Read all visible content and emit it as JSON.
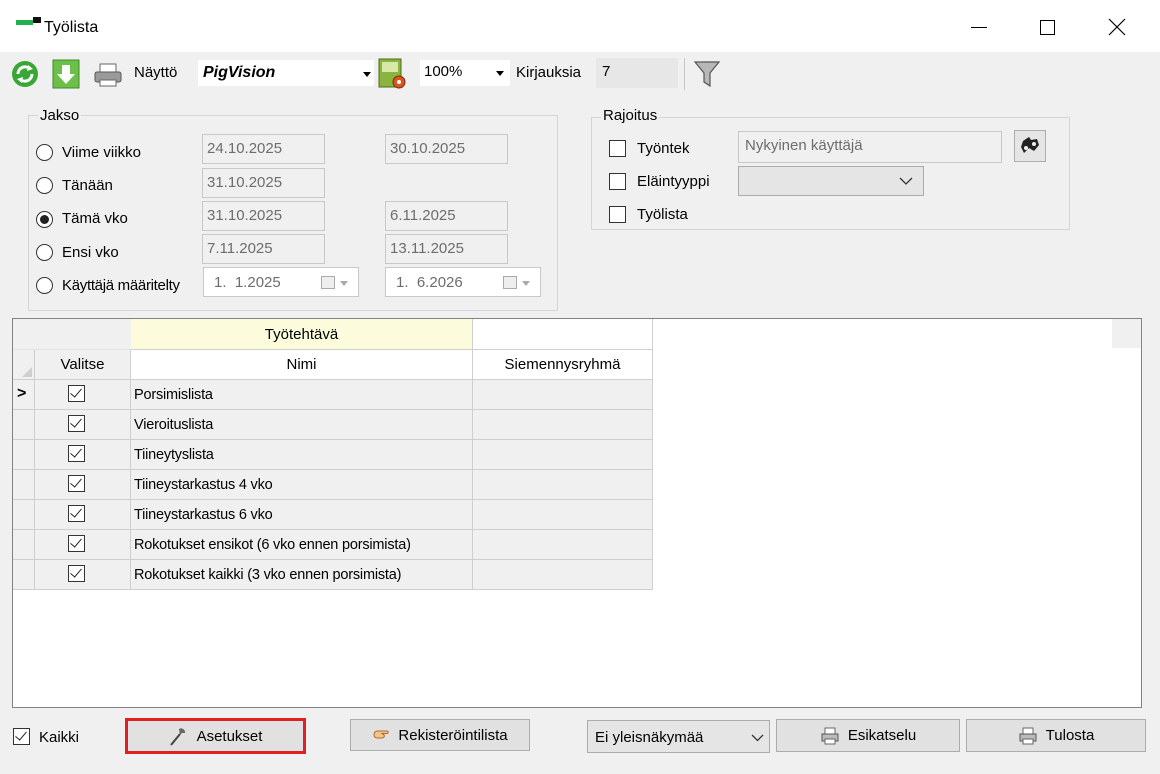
{
  "window": {
    "title": "Työlista",
    "minimize_icon": "minimize-icon",
    "maximize_icon": "maximize-icon",
    "close_icon": "close-icon"
  },
  "toolbar": {
    "refresh_icon": "refresh-icon",
    "export_icon": "download-arrow-icon",
    "print_icon": "printer-icon",
    "naytto_label": "Näyttö",
    "naytto_value": "PigVision",
    "settings_icon": "document-gear-icon",
    "zoom_value": "100%",
    "kirjauksia_label": "Kirjauksia",
    "kirjauksia_value": "7",
    "filter_icon": "funnel-icon"
  },
  "jakso": {
    "title": "Jakso",
    "options": [
      {
        "label": "Viime viikko",
        "from": "24.10.2025",
        "to": "30.10.2025",
        "selected": false
      },
      {
        "label": "Tänään",
        "from": "31.10.2025",
        "to": "",
        "selected": false
      },
      {
        "label": "Tämä vko",
        "from": "31.10.2025",
        "to": "6.11.2025",
        "selected": true
      },
      {
        "label": "Ensi vko",
        "from": "7.11.2025",
        "to": "13.11.2025",
        "selected": false
      },
      {
        "label": "Käyttäjä määritelty",
        "from": "1.  1.2025",
        "to": "1.  6.2026",
        "selected": false
      }
    ]
  },
  "rajoitus": {
    "title": "Rajoitus",
    "tyontek_label": "Työntek",
    "tyontek_value": "Nykyinen käyttäjä",
    "elaintyyppi_label": "Eläintyyppi",
    "tyolista_label": "Työlista",
    "binoculars_icon": "binoculars-icon"
  },
  "grid": {
    "band_header": "Työtehtävä",
    "columns": [
      "Valitse",
      "Nimi",
      "Siemennysryhmä"
    ],
    "current_row_marker": ">",
    "rows": [
      {
        "checked": true,
        "name": "Porsimislista",
        "group": ""
      },
      {
        "checked": true,
        "name": "Vieroituslista",
        "group": ""
      },
      {
        "checked": true,
        "name": "Tiineytyslista",
        "group": ""
      },
      {
        "checked": true,
        "name": "Tiineystarkastus 4 vko",
        "group": ""
      },
      {
        "checked": true,
        "name": "Tiineystarkastus 6 vko",
        "group": ""
      },
      {
        "checked": true,
        "name": "Rokotukset ensikot (6 vko ennen porsimista)",
        "group": ""
      },
      {
        "checked": true,
        "name": "Rokotukset kaikki (3 vko ennen porsimista)",
        "group": ""
      }
    ]
  },
  "bottom": {
    "kaikki_label": "Kaikki",
    "kaikki_checked": true,
    "asetukset_label": "Asetukset",
    "asetukset_icon": "wrench-icon",
    "rekisterointilista_label": "Rekisteröintilista",
    "rekisterointilista_icon": "hand-pointer-icon",
    "view_value": "Ei yleisnäkymää",
    "esikatselu_label": "Esikatselu",
    "tulosta_label": "Tulosta",
    "print_icon": "printer-icon",
    "highlight_color": "#e02020"
  }
}
